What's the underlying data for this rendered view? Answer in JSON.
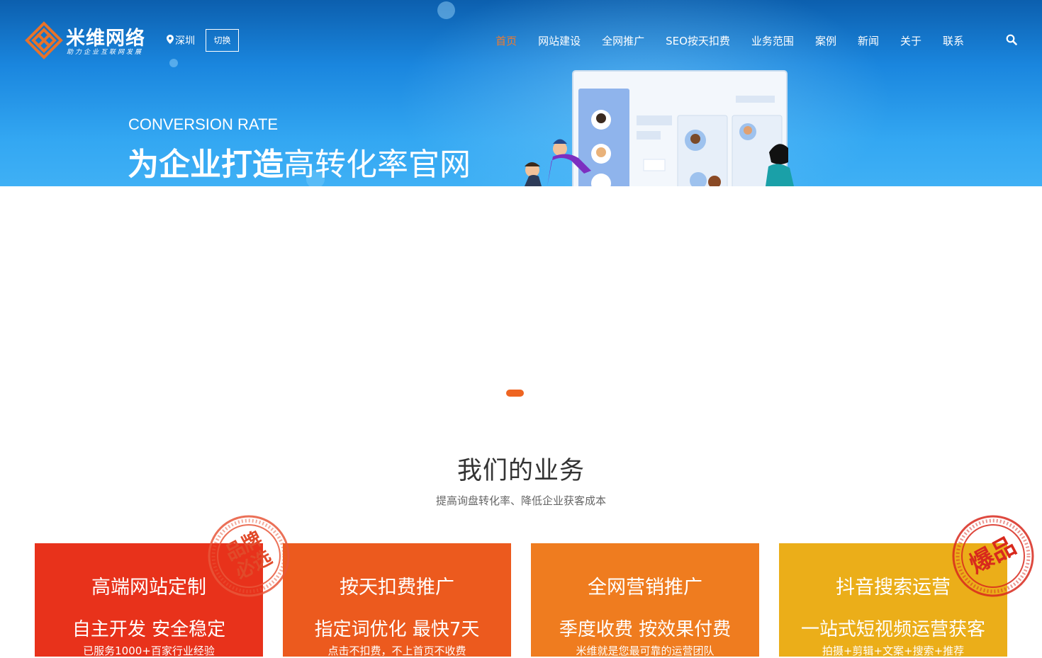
{
  "header": {
    "logo_title": "米维网络",
    "logo_slogan": "助力企业互联网发展",
    "city": "深圳",
    "switch_label": "切换",
    "nav": [
      {
        "label": "首页",
        "active": true
      },
      {
        "label": "网站建设"
      },
      {
        "label": "全网推广"
      },
      {
        "label": "SEO按天扣费"
      },
      {
        "label": "业务范围"
      },
      {
        "label": "案例"
      },
      {
        "label": "新闻"
      },
      {
        "label": "关于"
      },
      {
        "label": "联系"
      }
    ],
    "search_icon": "search-icon"
  },
  "banner": {
    "english": "CONVERSION RATE",
    "headline_bold": "为企业打造",
    "headline_rest": "高转化率官网"
  },
  "section": {
    "title": "我们的业务",
    "subtitle": "提高询盘转化率、降低企业获客成本"
  },
  "cards": [
    {
      "title": "高端网站定制",
      "headline": "自主开发 安全稳定",
      "desc": "已服务1000+百家行业经验"
    },
    {
      "title": "按天扣费推广",
      "headline": "指定词优化 最快7天",
      "desc": "点击不扣费，不上首页不收费"
    },
    {
      "title": "全网营销推广",
      "headline": "季度收费 按效果付费",
      "desc": "米维就是您最可靠的运营团队"
    },
    {
      "title": "抖音搜索运营",
      "headline": "一站式短视频运营获客",
      "desc": "拍摄+剪辑+文案+搜索+推荐"
    }
  ],
  "stamps": {
    "brand_pick": [
      "品牌",
      "必选"
    ],
    "hot_item": "爆品"
  },
  "colors": {
    "accent": "#ee6522",
    "card1": "#e8321b",
    "card2": "#ec5a1e",
    "card3": "#ef7c1f",
    "card4": "#ebae19"
  }
}
